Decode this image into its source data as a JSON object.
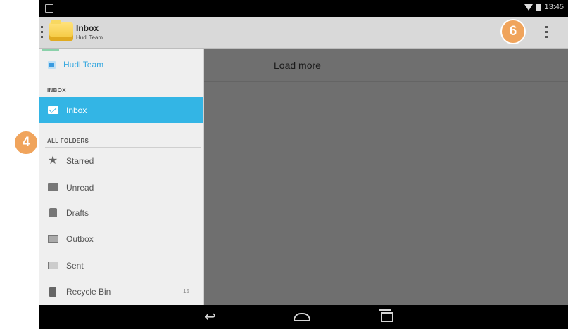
{
  "status_bar": {
    "time": "13:45"
  },
  "action_bar": {
    "title": "Inbox",
    "subtitle": "Hudl Team"
  },
  "drawer": {
    "account": "Hudl Team",
    "section_inbox": "INBOX",
    "inbox_label": "Inbox",
    "section_folders": "ALL FOLDERS",
    "folders": [
      {
        "label": "Starred",
        "icon": "star-icon"
      },
      {
        "label": "Unread",
        "icon": "unread-icon"
      },
      {
        "label": "Drafts",
        "icon": "drafts-icon"
      },
      {
        "label": "Outbox",
        "icon": "outbox-icon"
      },
      {
        "label": "Sent",
        "icon": "sent-icon"
      },
      {
        "label": "Recycle Bin",
        "icon": "trash-icon",
        "count": "15"
      }
    ]
  },
  "content": {
    "load_more": "Load more"
  },
  "callouts": {
    "left": "4",
    "right": "6"
  },
  "colors": {
    "selected": "#33b5e5",
    "callout": "#f0a45c",
    "account": "#3aa9df"
  }
}
